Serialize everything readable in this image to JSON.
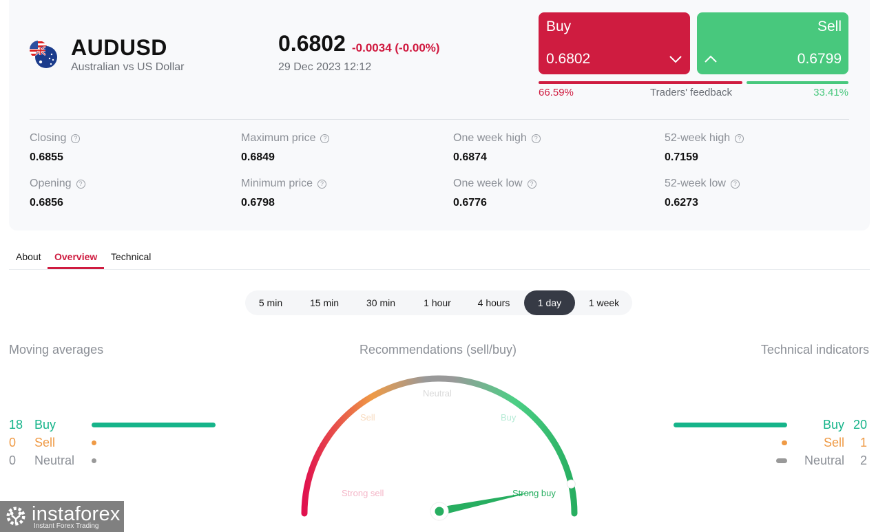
{
  "instrument": {
    "symbol": "AUDUSD",
    "description": "Australian vs US Dollar",
    "flag_icon": "aud-usd-flags-icon",
    "price": "0.6802",
    "change": "-0.0034 (-0.00%)",
    "datetime": "29 Dec 2023 12:12"
  },
  "trade": {
    "buy_label": "Buy",
    "buy_price": "0.6802",
    "sell_label": "Sell",
    "sell_price": "0.6799",
    "buy_icon": "chevron-down-icon",
    "sell_icon": "chevron-up-icon"
  },
  "feedback": {
    "label": "Traders' feedback",
    "buy_pct_text": "66.59%",
    "sell_pct_text": "33.41%",
    "buy_pct": 66.59,
    "sell_pct": 33.41
  },
  "stats": [
    {
      "label": "Closing",
      "value": "0.6855"
    },
    {
      "label": "Opening",
      "value": "0.6856"
    },
    {
      "label": "Maximum price",
      "value": "0.6849"
    },
    {
      "label": "Minimum price",
      "value": "0.6798"
    },
    {
      "label": "One week high",
      "value": "0.6874"
    },
    {
      "label": "One week low",
      "value": "0.6776"
    },
    {
      "label": "52-week high",
      "value": "0.7159"
    },
    {
      "label": "52-week low",
      "value": "0.6273"
    }
  ],
  "help_glyph": "?",
  "tabs": [
    {
      "label": "About",
      "active": false
    },
    {
      "label": "Overview",
      "active": true
    },
    {
      "label": "Technical",
      "active": false
    }
  ],
  "periods": [
    {
      "label": "5 min",
      "active": false
    },
    {
      "label": "15 min",
      "active": false
    },
    {
      "label": "30 min",
      "active": false
    },
    {
      "label": "1 hour",
      "active": false
    },
    {
      "label": "4 hours",
      "active": false
    },
    {
      "label": "1 day",
      "active": true
    },
    {
      "label": "1 week",
      "active": false
    }
  ],
  "moving_averages": {
    "title": "Moving averages",
    "rows": [
      {
        "count": "18",
        "label": "Buy",
        "color": "#16b48a"
      },
      {
        "count": "0",
        "label": "Sell",
        "color": "#ef9a45"
      },
      {
        "count": "0",
        "label": "Neutral",
        "color": "#999999"
      }
    ]
  },
  "technical_indicators": {
    "title": "Technical indicators",
    "rows": [
      {
        "count": "20",
        "label": "Buy",
        "color": "#16b48a"
      },
      {
        "count": "1",
        "label": "Sell",
        "color": "#ef9a45"
      },
      {
        "count": "2",
        "label": "Neutral",
        "color": "#999999"
      }
    ]
  },
  "recommendations": {
    "title": "Recommendations (sell/buy)",
    "zones": [
      "Strong sell",
      "Sell",
      "Neutral",
      "Buy",
      "Strong buy"
    ],
    "current": "Strong buy",
    "needle_value": 0.93
  },
  "colors": {
    "sell_red": "#cf1c40",
    "buy_green": "#48c87d",
    "indicator_green": "#16b48a",
    "indicator_orange": "#ef9a45",
    "neutral_gray": "#999999",
    "gauge_needle": "#27ae60"
  },
  "watermark": {
    "brand": "instaforex",
    "tagline": "Instant Forex Trading"
  }
}
